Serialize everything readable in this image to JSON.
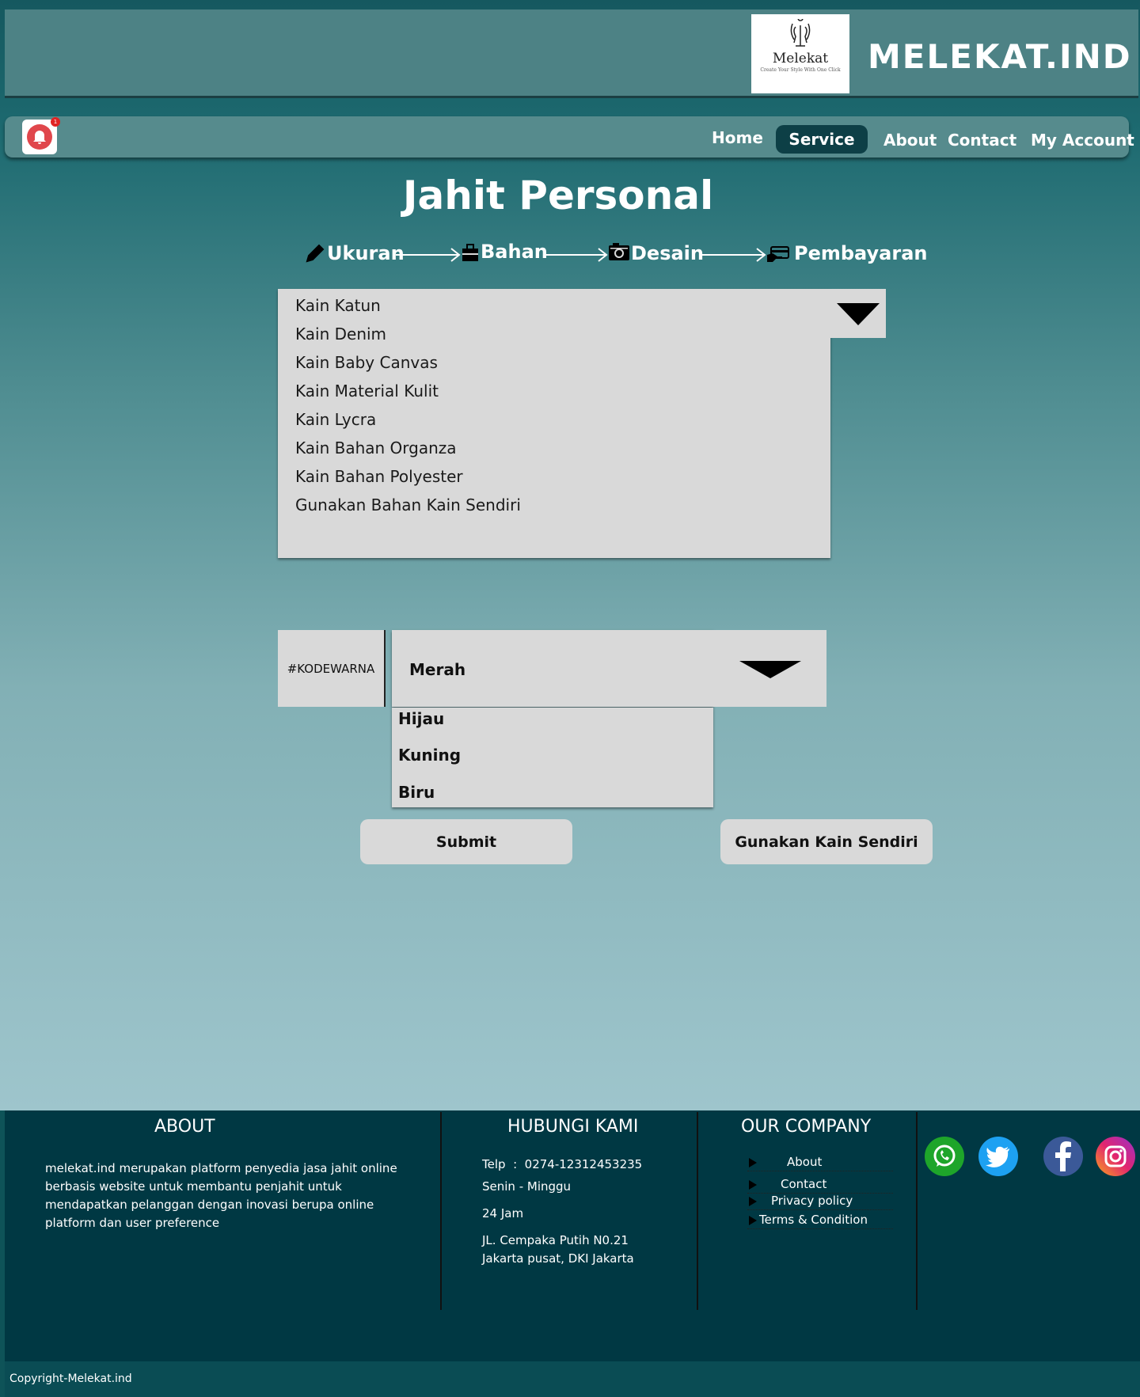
{
  "header": {
    "logo_name": "Melekat",
    "logo_tagline": "Create Your Style With One Click",
    "brand": "MELEKAT.IND"
  },
  "nav": {
    "notification_count": "1",
    "items": [
      {
        "label": "Home"
      },
      {
        "label": "Service",
        "active": true
      },
      {
        "label": "About"
      },
      {
        "label": "Contact"
      },
      {
        "label": "My Account"
      }
    ]
  },
  "main": {
    "title": "Jahit Personal",
    "steps": [
      {
        "label": "Ukuran",
        "icon": "pencil-icon"
      },
      {
        "label": "Bahan",
        "icon": "briefcase-icon"
      },
      {
        "label": "Desain",
        "icon": "camera-icon"
      },
      {
        "label": "Pembayaran",
        "icon": "payment-icon"
      }
    ],
    "fabric_options": [
      "Kain Katun",
      "Kain Denim",
      "Kain Baby Canvas",
      "Kain Material Kulit",
      "Kain Lycra",
      "Kain Bahan Organza",
      "Kain Bahan Polyester",
      "Gunakan Bahan Kain Sendiri"
    ],
    "color": {
      "code_label": "#KODEWARNA",
      "selected": "Merah",
      "options": [
        "Hijau",
        "Kuning",
        "Biru"
      ]
    },
    "buttons": {
      "submit": "Submit",
      "own_fabric": "Gunakan Kain Sendiri"
    }
  },
  "footer": {
    "about": {
      "heading": "ABOUT",
      "text": "melekat.ind merupakan platform penyedia jasa jahit online berbasis website untuk membantu penjahit untuk mendapatkan pelanggan dengan inovasi berupa online platform dan user preference"
    },
    "contact": {
      "heading": "HUBUNGI KAMI",
      "phone": "Telp  :  0274-12312453235",
      "days": "Senin - Minggu",
      "hours": "24 Jam",
      "address_line1": "JL. Cempaka Putih N0.21",
      "address_line2": "Jakarta pusat, DKI Jakarta"
    },
    "company": {
      "heading": "OUR COMPANY",
      "links": [
        "About",
        "Contact",
        "Privacy policy",
        "Terms & Condition"
      ]
    },
    "social": [
      "whatsapp-icon",
      "twitter-icon",
      "facebook-icon",
      "instagram-icon"
    ],
    "copyright": "Copyright-Melekat.ind"
  },
  "colors": {
    "header_bg": "#4d8285",
    "nav_active": "#0d3f46",
    "footer_bg": "#003843",
    "panel_bg": "#d9d9d9"
  }
}
